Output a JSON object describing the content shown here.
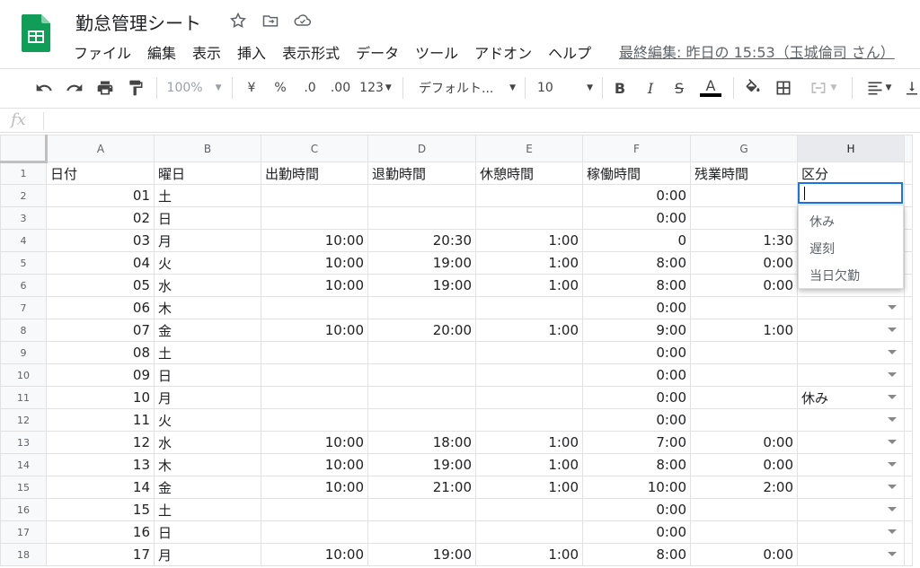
{
  "document": {
    "title": "勤怠管理シート",
    "last_edit": "最終編集: 昨日の 15:53（玉城倫司 さん）"
  },
  "menu": [
    "ファイル",
    "編集",
    "表示",
    "挿入",
    "表示形式",
    "データ",
    "ツール",
    "アドオン",
    "ヘルプ"
  ],
  "toolbar": {
    "zoom": "100%",
    "currency": "¥",
    "percent": "%",
    "dec_decrease": ".0",
    "dec_increase": ".00",
    "more_formats": "123",
    "font": "デフォルト...",
    "font_size": "10",
    "bold": "B",
    "italic": "I",
    "strike": "S",
    "text_color": "A"
  },
  "formula_bar": {
    "fx": "fx"
  },
  "columns": [
    "A",
    "B",
    "C",
    "D",
    "E",
    "F",
    "G",
    "H"
  ],
  "header_row": [
    "日付",
    "曜日",
    "出勤時間",
    "退勤時間",
    "休憩時間",
    "稼働時間",
    "残業時間",
    "区分"
  ],
  "rows": [
    {
      "n": "2",
      "a": "01",
      "b": "土",
      "c": "",
      "d": "",
      "e": "",
      "f": "0:00",
      "g": "",
      "h": ""
    },
    {
      "n": "3",
      "a": "02",
      "b": "日",
      "c": "",
      "d": "",
      "e": "",
      "f": "0:00",
      "g": "",
      "h": ""
    },
    {
      "n": "4",
      "a": "03",
      "b": "月",
      "c": "10:00",
      "d": "20:30",
      "e": "1:00",
      "f": "0",
      "g": "1:30",
      "h": ""
    },
    {
      "n": "5",
      "a": "04",
      "b": "火",
      "c": "10:00",
      "d": "19:00",
      "e": "1:00",
      "f": "8:00",
      "g": "0:00",
      "h": ""
    },
    {
      "n": "6",
      "a": "05",
      "b": "水",
      "c": "10:00",
      "d": "19:00",
      "e": "1:00",
      "f": "8:00",
      "g": "0:00",
      "h": ""
    },
    {
      "n": "7",
      "a": "06",
      "b": "木",
      "c": "",
      "d": "",
      "e": "",
      "f": "0:00",
      "g": "",
      "h": ""
    },
    {
      "n": "8",
      "a": "07",
      "b": "金",
      "c": "10:00",
      "d": "20:00",
      "e": "1:00",
      "f": "9:00",
      "g": "1:00",
      "h": ""
    },
    {
      "n": "9",
      "a": "08",
      "b": "土",
      "c": "",
      "d": "",
      "e": "",
      "f": "0:00",
      "g": "",
      "h": ""
    },
    {
      "n": "10",
      "a": "09",
      "b": "日",
      "c": "",
      "d": "",
      "e": "",
      "f": "0:00",
      "g": "",
      "h": ""
    },
    {
      "n": "11",
      "a": "10",
      "b": "月",
      "c": "",
      "d": "",
      "e": "",
      "f": "0:00",
      "g": "",
      "h": "休み"
    },
    {
      "n": "12",
      "a": "11",
      "b": "火",
      "c": "",
      "d": "",
      "e": "",
      "f": "0:00",
      "g": "",
      "h": ""
    },
    {
      "n": "13",
      "a": "12",
      "b": "水",
      "c": "10:00",
      "d": "18:00",
      "e": "1:00",
      "f": "7:00",
      "g": "0:00",
      "h": ""
    },
    {
      "n": "14",
      "a": "13",
      "b": "木",
      "c": "10:00",
      "d": "19:00",
      "e": "1:00",
      "f": "8:00",
      "g": "0:00",
      "h": ""
    },
    {
      "n": "15",
      "a": "14",
      "b": "金",
      "c": "10:00",
      "d": "21:00",
      "e": "1:00",
      "f": "10:00",
      "g": "2:00",
      "h": ""
    },
    {
      "n": "16",
      "a": "15",
      "b": "土",
      "c": "",
      "d": "",
      "e": "",
      "f": "0:00",
      "g": "",
      "h": ""
    },
    {
      "n": "17",
      "a": "16",
      "b": "日",
      "c": "",
      "d": "",
      "e": "",
      "f": "0:00",
      "g": "",
      "h": ""
    },
    {
      "n": "18",
      "a": "17",
      "b": "月",
      "c": "10:00",
      "d": "19:00",
      "e": "1:00",
      "f": "8:00",
      "g": "0:00",
      "h": ""
    }
  ],
  "dropdown_options": [
    "休み",
    "遅刻",
    "当日欠勤"
  ],
  "colors": {
    "accent": "#1a73e8",
    "sheets_green": "#0f9d58"
  }
}
